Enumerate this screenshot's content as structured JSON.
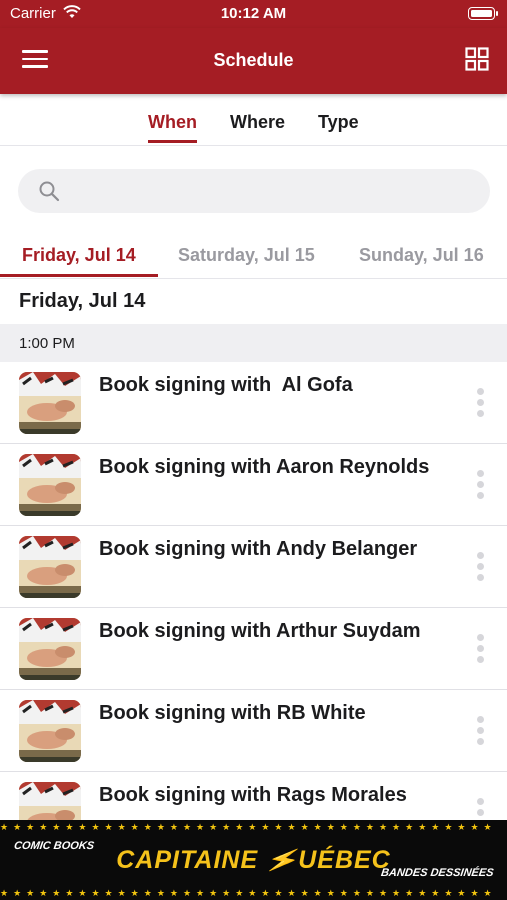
{
  "status_bar": {
    "carrier": "Carrier",
    "time": "10:12 AM"
  },
  "nav": {
    "title": "Schedule",
    "color": "#a51d24"
  },
  "view_tabs": [
    {
      "label": "When",
      "active": true
    },
    {
      "label": "Where",
      "active": false
    },
    {
      "label": "Type",
      "active": false
    }
  ],
  "search": {
    "placeholder": ""
  },
  "day_tabs": [
    {
      "label": "Friday, Jul 14",
      "active": true
    },
    {
      "label": "Saturday, Jul 15",
      "active": false
    },
    {
      "label": "Sunday, Jul 16",
      "active": false
    }
  ],
  "date_heading": "Friday, Jul 14",
  "time_slot": "1:00 PM",
  "events": [
    {
      "title": "Book signing with  Al Gofa"
    },
    {
      "title": "Book signing with Aaron Reynolds"
    },
    {
      "title": "Book signing with Andy Belanger"
    },
    {
      "title": "Book signing with Arthur Suydam"
    },
    {
      "title": "Book signing with RB White"
    },
    {
      "title": "Book signing with Rags Morales"
    }
  ],
  "banner": {
    "left_text": "COMIC BOOKS",
    "logo_left": "CAPITAINE ",
    "logo_right": "UÉBEC",
    "right_text": "BANDES DESSINÉES",
    "accent": "#f5c21b"
  }
}
